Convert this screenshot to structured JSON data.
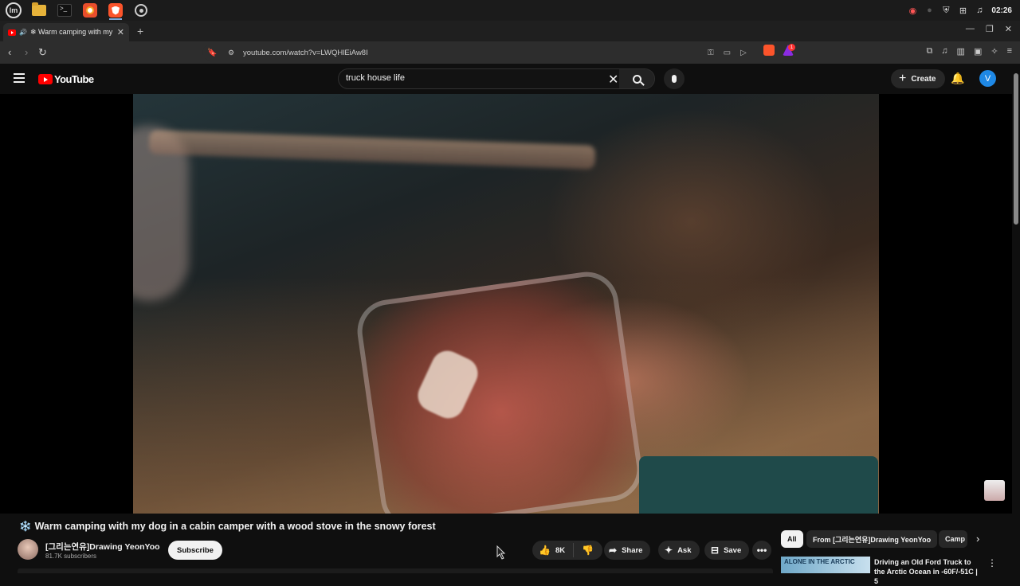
{
  "os_taskbar": {
    "apps": [
      "mint-menu",
      "files",
      "terminal",
      "firefox",
      "brave",
      "chromium"
    ],
    "clock": "02:26"
  },
  "browser": {
    "tab_title": "Warm camping with my dog in a cabin camper with a wood stove in the snowy forest",
    "tab_title_display": "❄ Warm camping with my",
    "url": "youtube.com/watch?v=LWQHlEiAw8I",
    "new_tab_label": "+",
    "brave_shield_badge": "1"
  },
  "youtube": {
    "logo_text": "YouTube",
    "search": {
      "value": "truck house life",
      "placeholder": "Search"
    },
    "create_label": "Create",
    "avatar_letter": "V"
  },
  "video": {
    "title": "Warm camping with my dog in a cabin camper with a wood stove in the snowy forest",
    "title_emoji": "❄️",
    "channel_name": "[그리는연유]Drawing YeonYoo",
    "subscribers": "81.7K subscribers",
    "subscribe_label": "Subscribe",
    "like_count": "8K",
    "share_label": "Share",
    "ask_label": "Ask",
    "save_label": "Save"
  },
  "recommendations": {
    "chips": [
      "All",
      "From [그리는연유]Drawing YeonYoo",
      "Camp"
    ],
    "selected_chip": "All",
    "first": {
      "thumb_text": "ALONE IN THE ARCTIC",
      "title": "Driving an Old Ford Truck to the Arctic Ocean in -60F/-51C | 5"
    }
  },
  "colors": {
    "background": "#0f0f0f",
    "brand_red": "#ff0000",
    "avatar_blue": "#1e88e5",
    "pill": "#272727"
  }
}
